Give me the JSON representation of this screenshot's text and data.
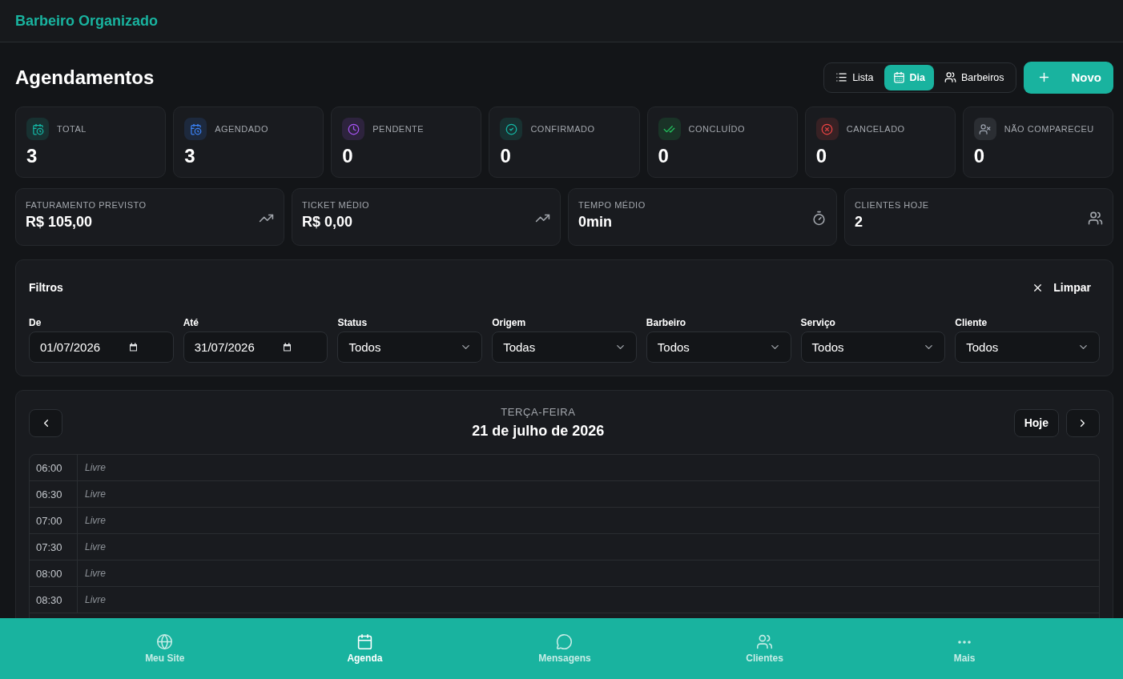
{
  "header": {
    "brand": "Barbeiro Organizado"
  },
  "page": {
    "title": "Agendamentos"
  },
  "view_tabs": [
    {
      "label": "Lista",
      "selected": false
    },
    {
      "label": "Dia",
      "selected": true
    },
    {
      "label": "Barbeiros",
      "selected": false
    }
  ],
  "new_button": {
    "label": "Novo"
  },
  "status_cards": [
    {
      "label": "TOTAL",
      "value": "3",
      "color": "#14b8a6"
    },
    {
      "label": "AGENDADO",
      "value": "3",
      "color": "#3b82f6"
    },
    {
      "label": "PENDENTE",
      "value": "0",
      "color": "#a855f7"
    },
    {
      "label": "CONFIRMADO",
      "value": "0",
      "color": "#14b8a6"
    },
    {
      "label": "CONCLUÍDO",
      "value": "0",
      "color": "#22c55e"
    },
    {
      "label": "CANCELADO",
      "value": "0",
      "color": "#ef4444"
    },
    {
      "label": "NÃO COMPARECEU",
      "value": "0",
      "color": "#9ca3af"
    }
  ],
  "metric_cards": [
    {
      "label": "FATURAMENTO PREVISTO",
      "value": "R$ 105,00"
    },
    {
      "label": "TICKET MÉDIO",
      "value": "R$ 0,00"
    },
    {
      "label": "TEMPO MÉDIO",
      "value": "0min"
    },
    {
      "label": "CLIENTES HOJE",
      "value": "2"
    }
  ],
  "filters": {
    "title": "Filtros",
    "clear_button": "Limpar",
    "fields": [
      {
        "label": "De",
        "kind": "date",
        "value": "01/07/2026"
      },
      {
        "label": "Até",
        "kind": "date",
        "value": "31/07/2026"
      },
      {
        "label": "Status",
        "kind": "select",
        "value": "Todos"
      },
      {
        "label": "Origem",
        "kind": "select",
        "value": "Todas"
      },
      {
        "label": "Barbeiro",
        "kind": "select",
        "value": "Todos"
      },
      {
        "label": "Serviço",
        "kind": "select",
        "value": "Todos"
      },
      {
        "label": "Cliente",
        "kind": "select",
        "value": "Todos"
      }
    ]
  },
  "day_view": {
    "weekday": "TERÇA-FEIRA",
    "date": "21 de julho de 2026",
    "today_button": "Hoje",
    "slots": [
      {
        "time": "06:00",
        "status": "Livre"
      },
      {
        "time": "06:30",
        "status": "Livre"
      },
      {
        "time": "07:00",
        "status": "Livre"
      },
      {
        "time": "07:30",
        "status": "Livre"
      },
      {
        "time": "08:00",
        "status": "Livre"
      },
      {
        "time": "08:30",
        "status": "Livre"
      }
    ]
  },
  "bottom_nav": [
    {
      "label": "Meu Site",
      "selected": false
    },
    {
      "label": "Agenda",
      "selected": true
    },
    {
      "label": "Mensagens",
      "selected": false
    },
    {
      "label": "Clientes",
      "selected": false
    },
    {
      "label": "Mais",
      "selected": false
    }
  ]
}
